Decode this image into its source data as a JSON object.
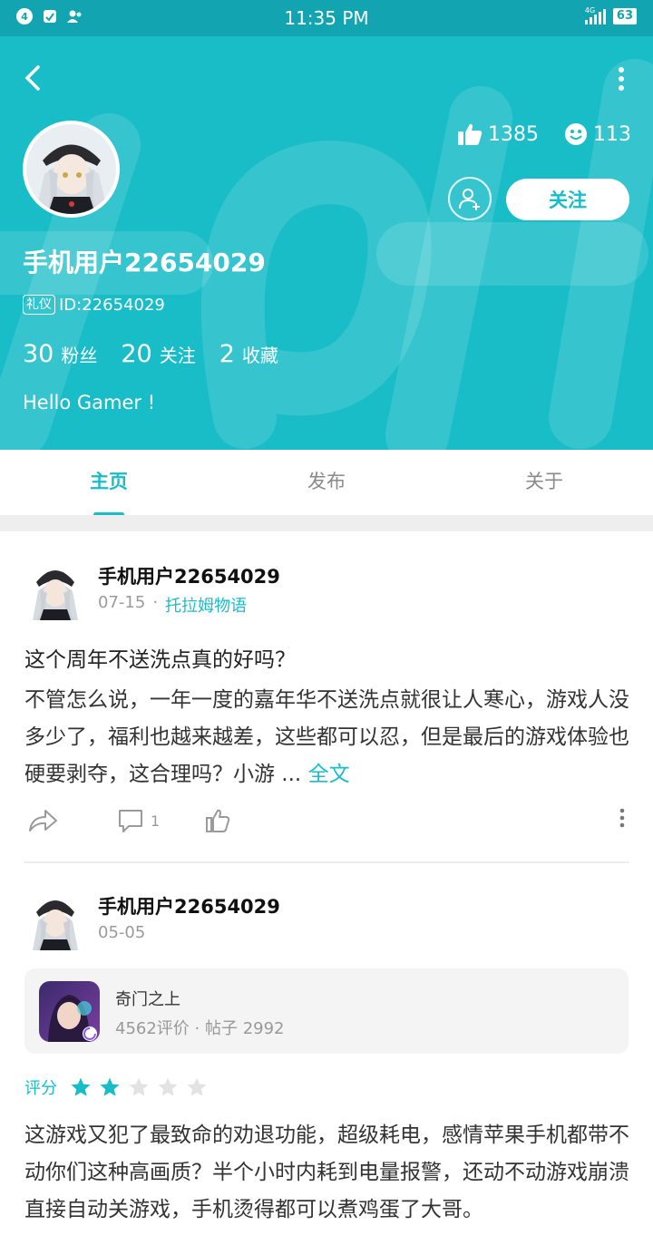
{
  "status_bar": {
    "notification_count": "4",
    "time": "11:35 PM",
    "network": "4G",
    "battery": "63",
    "colors": {
      "bar": "#12a4b0"
    }
  },
  "profile": {
    "username": "手机用户22654029",
    "badge": "礼仪",
    "id": "ID:22654029",
    "likes": "1385",
    "smiles": "113",
    "follow_label": "关注",
    "counts": [
      {
        "num": "30",
        "label": "粉丝"
      },
      {
        "num": "20",
        "label": "关注"
      },
      {
        "num": "2",
        "label": "收藏"
      }
    ],
    "bio": "Hello Gamer !",
    "watermark_text": "apTap",
    "colors": {
      "header": "#19bdc8",
      "accent": "#19bdc8"
    }
  },
  "tabs": [
    {
      "label": "主页",
      "active": true
    },
    {
      "label": "发布",
      "active": false
    },
    {
      "label": "关于",
      "active": false
    }
  ],
  "posts": [
    {
      "author": "手机用户22654029",
      "date": "07-15",
      "separator": "·",
      "game": "托拉姆物语",
      "title": "这个周年不送洗点真的好吗？",
      "body": "不管怎么说，一年一度的嘉年华不送洗点就很让人寒心，游戏人没多少了，福利也越来越差，这些都可以忍，但是最后的游戏体验也硬要剥夺，这合理吗？小游 ...",
      "read_more": "全文",
      "comment_count": "1"
    },
    {
      "author": "手机用户22654029",
      "date": "05-05",
      "game_card": {
        "name": "奇门之上",
        "stats": "4562评价 · 帖子 2992"
      },
      "rating_label": "评分",
      "rating": 2,
      "rating_max": 5,
      "body": "这游戏又犯了最致命的劝退功能，超级耗电，感情苹果手机都带不动你们这种高画质？半个小时内耗到电量报警，还动不动游戏崩溃直接自动关游戏，手机烫得都可以煮鸡蛋了大哥。"
    }
  ]
}
